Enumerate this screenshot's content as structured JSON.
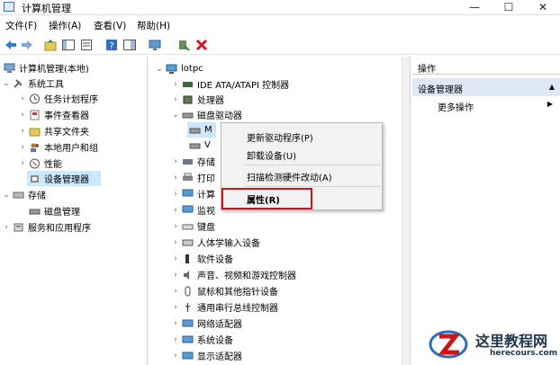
{
  "window": {
    "title": "计算机管理",
    "minimize": "—",
    "maximize": "☐",
    "close": "✕"
  },
  "menu": [
    "文件(F)",
    "操作(A)",
    "查看(V)",
    "帮助(H)"
  ],
  "left_tree": {
    "root": "计算机管理(本地)",
    "system_tools": "系统工具",
    "task_scheduler": "任务计划程序",
    "event_viewer": "事件查看器",
    "shared_folders": "共享文件夹",
    "local_users": "本地用户和组",
    "performance": "性能",
    "device_manager": "设备管理器",
    "storage": "存储",
    "disk_management": "磁盘管理",
    "services_apps": "服务和应用程序"
  },
  "device_tree": {
    "computer": "lotpc",
    "ide": "IDE ATA/ATAPI 控制器",
    "processor": "处理器",
    "disk_drives": "磁盘驱动器",
    "disk1": "M",
    "disk2": "V",
    "storage_ctrl": "存储",
    "print_queue": "打印",
    "computer_node": "计算",
    "monitors": "监视",
    "keyboard": "键盘",
    "hid": "人体学输入设备",
    "software": "软件设备",
    "sound": "声音、视频和游戏控制器",
    "mice": "鼠标和其他指针设备",
    "usb": "通用串行总线控制器",
    "network": "网络适配器",
    "system": "系统设备",
    "display": "显示适配器"
  },
  "context_menu": {
    "update_driver": "更新驱动程序(P)",
    "uninstall": "卸载设备(U)",
    "scan": "扫描检测硬件改动(A)",
    "properties": "属性(R)"
  },
  "actions": {
    "header": "操作",
    "section": "设备管理器",
    "more": "更多操作"
  },
  "watermark": {
    "text": "这里教程网",
    "url": "herecours.com"
  },
  "colors": {
    "highlight_box": "#c9161b",
    "selection": "#cce8ff",
    "action_section": "#dfe9f5"
  }
}
